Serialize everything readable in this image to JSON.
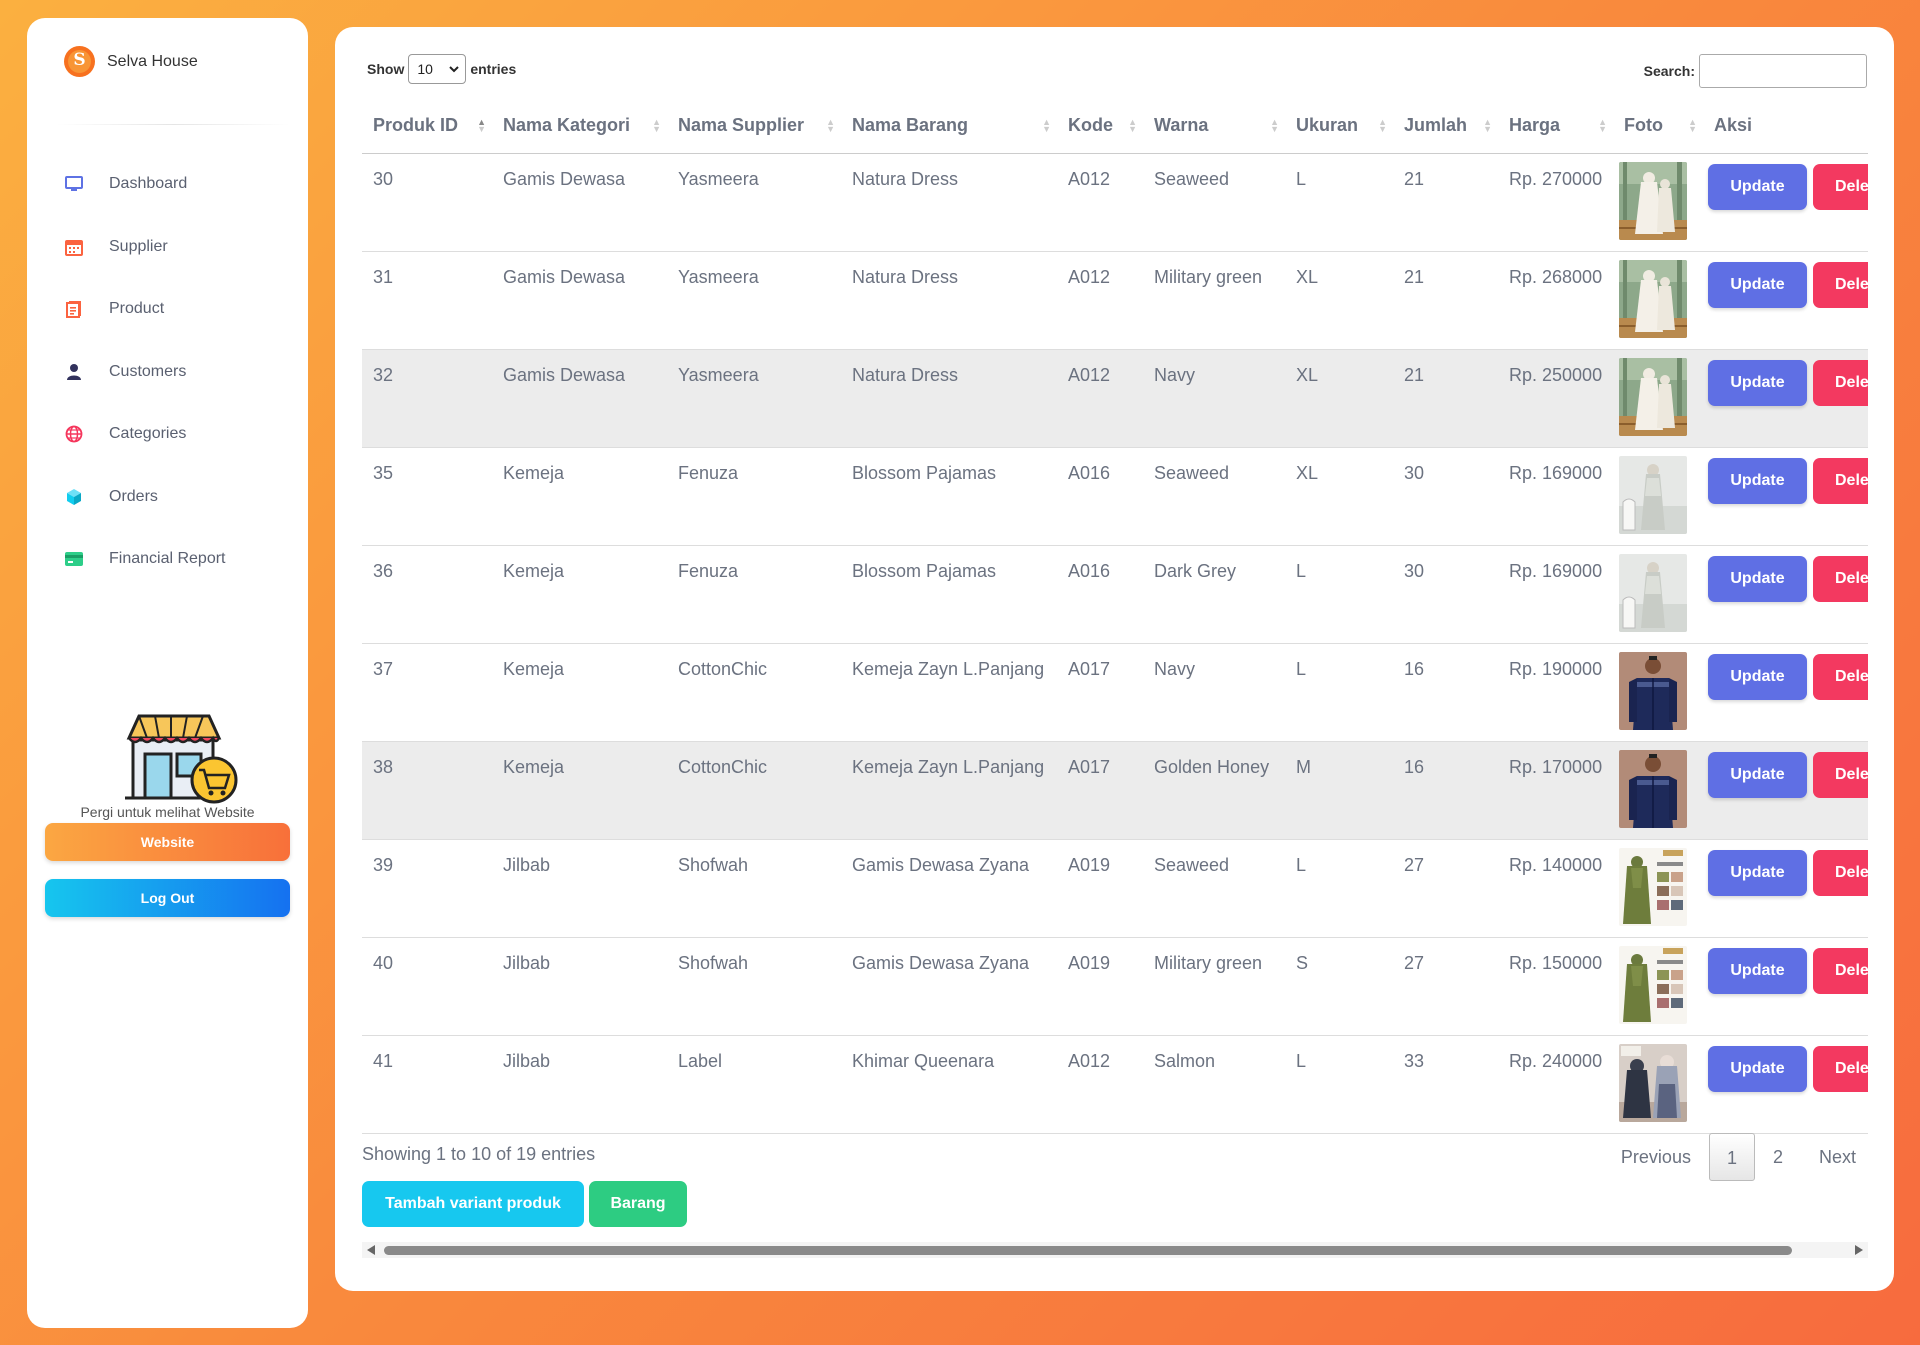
{
  "sidebar": {
    "brand": "Selva House",
    "brand_logo_letter": "S",
    "nav": [
      {
        "label": "Dashboard",
        "icon": "monitor-icon",
        "color": "#5e72e4"
      },
      {
        "label": "Supplier",
        "icon": "calendar-icon",
        "color": "#fb6340"
      },
      {
        "label": "Product",
        "icon": "document-icon",
        "color": "#fb6340"
      },
      {
        "label": "Customers",
        "icon": "user-icon",
        "color": "#32325d"
      },
      {
        "label": "Categories",
        "icon": "globe-icon",
        "color": "#f5365c"
      },
      {
        "label": "Orders",
        "icon": "cube-icon",
        "color": "#11cdef"
      },
      {
        "label": "Financial Report",
        "icon": "credit-card-icon",
        "color": "#2dce89"
      }
    ],
    "visit_text": "Pergi untuk melihat Website",
    "website_button": "Website",
    "logout_button": "Log Out"
  },
  "table_controls": {
    "show_label": "Show",
    "entries_label": "entries",
    "page_size": "10",
    "search_label": "Search:",
    "search_value": ""
  },
  "table": {
    "columns": [
      "Produk ID",
      "Nama Kategori",
      "Nama Supplier",
      "Nama Barang",
      "Kode",
      "Warna",
      "Ukuran",
      "Jumlah",
      "Harga",
      "Foto",
      "Aksi"
    ],
    "sorted_column": "Produk ID",
    "sort_direction": "ascending",
    "update_label": "Update",
    "delete_label": "Delete",
    "rows": [
      {
        "id": "30",
        "kategori": "Gamis Dewasa",
        "supplier": "Yasmeera",
        "barang": "Natura Dress",
        "kode": "A012",
        "warna": "Seaweed",
        "ukuran": "L",
        "jumlah": "21",
        "harga": "Rp. 270000",
        "foto": "gamis-natura-photo"
      },
      {
        "id": "31",
        "kategori": "Gamis Dewasa",
        "supplier": "Yasmeera",
        "barang": "Natura Dress",
        "kode": "A012",
        "warna": "Military green",
        "ukuran": "XL",
        "jumlah": "21",
        "harga": "Rp. 268000",
        "foto": "gamis-natura-photo"
      },
      {
        "id": "32",
        "kategori": "Gamis Dewasa",
        "supplier": "Yasmeera",
        "barang": "Natura Dress",
        "kode": "A012",
        "warna": "Navy",
        "ukuran": "XL",
        "jumlah": "21",
        "harga": "Rp. 250000",
        "foto": "gamis-natura-photo"
      },
      {
        "id": "35",
        "kategori": "Kemeja",
        "supplier": "Fenuza",
        "barang": "Blossom Pajamas",
        "kode": "A016",
        "warna": "Seaweed",
        "ukuran": "XL",
        "jumlah": "30",
        "harga": "Rp. 169000",
        "foto": "blossom-pajamas-photo"
      },
      {
        "id": "36",
        "kategori": "Kemeja",
        "supplier": "Fenuza",
        "barang": "Blossom Pajamas",
        "kode": "A016",
        "warna": "Dark Grey",
        "ukuran": "L",
        "jumlah": "30",
        "harga": "Rp. 169000",
        "foto": "blossom-pajamas-photo"
      },
      {
        "id": "37",
        "kategori": "Kemeja",
        "supplier": "CottonChic",
        "barang": "Kemeja Zayn L.Panjang",
        "kode": "A017",
        "warna": "Navy",
        "ukuran": "L",
        "jumlah": "16",
        "harga": "Rp. 190000",
        "foto": "kemeja-zayn-photo"
      },
      {
        "id": "38",
        "kategori": "Kemeja",
        "supplier": "CottonChic",
        "barang": "Kemeja Zayn L.Panjang",
        "kode": "A017",
        "warna": "Golden Honey",
        "ukuran": "M",
        "jumlah": "16",
        "harga": "Rp. 170000",
        "foto": "kemeja-zayn-photo"
      },
      {
        "id": "39",
        "kategori": "Jilbab",
        "supplier": "Shofwah",
        "barang": "Gamis Dewasa Zyana",
        "kode": "A019",
        "warna": "Seaweed",
        "ukuran": "L",
        "jumlah": "27",
        "harga": "Rp. 140000",
        "foto": "gamis-zyana-photo"
      },
      {
        "id": "40",
        "kategori": "Jilbab",
        "supplier": "Shofwah",
        "barang": "Gamis Dewasa Zyana",
        "kode": "A019",
        "warna": "Military green",
        "ukuran": "S",
        "jumlah": "27",
        "harga": "Rp. 150000",
        "foto": "gamis-zyana-photo"
      },
      {
        "id": "41",
        "kategori": "Jilbab",
        "supplier": "Label",
        "barang": "Khimar Queenara",
        "kode": "A012",
        "warna": "Salmon",
        "ukuran": "L",
        "jumlah": "33",
        "harga": "Rp. 240000",
        "foto": "khimar-queenara-photo"
      }
    ]
  },
  "footer": {
    "info": "Showing 1 to 10 of 19 entries",
    "previous": "Previous",
    "pages": [
      "1",
      "2"
    ],
    "current_page": "1",
    "next": "Next",
    "tambah_button": "Tambah variant produk",
    "barang_button": "Barang"
  }
}
